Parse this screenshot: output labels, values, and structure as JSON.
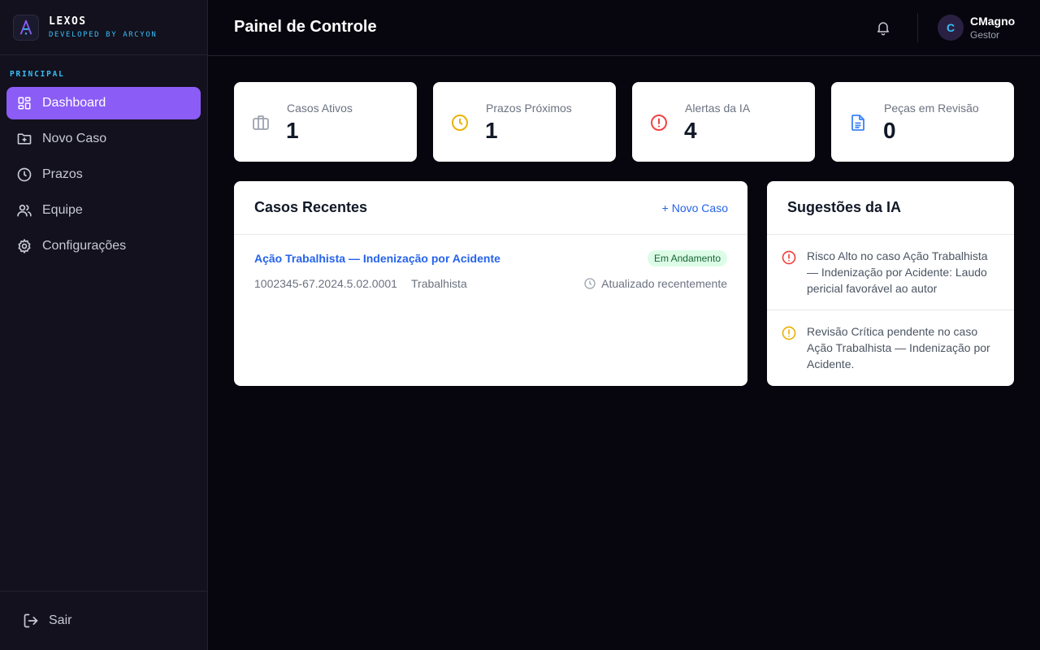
{
  "brand": {
    "name": "LEXOS",
    "subtitle": "DEVELOPED BY ARCYON"
  },
  "sidebar": {
    "section_label": "PRINCIPAL",
    "items": [
      {
        "label": "Dashboard",
        "icon": "dashboard-icon",
        "active": true
      },
      {
        "label": "Novo Caso",
        "icon": "folder-plus-icon",
        "active": false
      },
      {
        "label": "Prazos",
        "icon": "clock-icon",
        "active": false
      },
      {
        "label": "Equipe",
        "icon": "users-icon",
        "active": false
      },
      {
        "label": "Configurações",
        "icon": "gear-icon",
        "active": false
      }
    ],
    "logout_label": "Sair"
  },
  "header": {
    "title": "Painel de Controle",
    "user": {
      "initial": "C",
      "name": "CMagno",
      "role": "Gestor"
    }
  },
  "stats": [
    {
      "label": "Casos Ativos",
      "value": "1",
      "icon": "briefcase-icon",
      "color": "#9ca3af"
    },
    {
      "label": "Prazos Próximos",
      "value": "1",
      "icon": "clock-icon",
      "color": "#eab308"
    },
    {
      "label": "Alertas da IA",
      "value": "4",
      "icon": "alert-circle-icon",
      "color": "#ef4444"
    },
    {
      "label": "Peças em Revisão",
      "value": "0",
      "icon": "document-icon",
      "color": "#3b82f6"
    }
  ],
  "recent_cases": {
    "title": "Casos Recentes",
    "action_label": "+ Novo Caso",
    "items": [
      {
        "title": "Ação Trabalhista — Indenização por Acidente",
        "status": "Em Andamento",
        "number": "1002345-67.2024.5.02.0001",
        "area": "Trabalhista",
        "updated": "Atualizado recentemente"
      }
    ]
  },
  "ai_suggestions": {
    "title": "Sugestões da IA",
    "items": [
      {
        "text": "Risco Alto no caso Ação Trabalhista — Indenização por Acidente: Laudo pericial favorável ao autor",
        "icon": "alert-circle-icon",
        "color": "#ef4444"
      },
      {
        "text": "Revisão Crítica pendente no caso Ação Trabalhista — Indenização por Acidente.",
        "icon": "alert-circle-icon",
        "color": "#eab308"
      }
    ]
  },
  "colors": {
    "accent": "#8b5cf6",
    "brand_cyan": "#38bdf8",
    "link": "#2563eb",
    "background": "#07060e",
    "sidebar": "#12111d"
  }
}
